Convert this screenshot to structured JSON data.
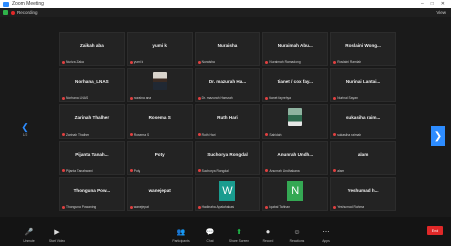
{
  "window": {
    "title": "Zoom Meeting",
    "controls": [
      "–",
      "□",
      "✕"
    ]
  },
  "infobar": {
    "recording": "Recording",
    "view": "View"
  },
  "participants": [
    {
      "name": "Zaikah aba",
      "label": "Nuriza Zaka"
    },
    {
      "name": "yumi k",
      "label": "yumi k"
    },
    {
      "name": "Nuraisha",
      "label": "Nuraisha"
    },
    {
      "name": "Nuraimah Abu...",
      "label": "Nuraimah Ramadong"
    },
    {
      "name": "Roslaini Wong...",
      "label": "Roslaini Ramlah"
    },
    {
      "name": "Norhana_LNAS",
      "label": "Norhana LNAS"
    },
    {
      "name": "",
      "label": "noraina ana",
      "avatar": "person"
    },
    {
      "name": "Dr. mazurah Ha...",
      "label": "Dr. mazurah Hamzah"
    },
    {
      "name": "tianet / cox fay...",
      "label": "tianet fayrehya"
    },
    {
      "name": "Nurinai Lantai...",
      "label": "Nurinai Sayan"
    },
    {
      "name": "Zarinah Thalher",
      "label": "Zarinah Thalher"
    },
    {
      "name": "Rosema S",
      "label": "Rosema S"
    },
    {
      "name": "Ruth Hari",
      "label": "Ruth Hari"
    },
    {
      "name": "",
      "label": "Sahidah",
      "avatar": "scene"
    },
    {
      "name": "sukasiha raim...",
      "label": "sukasiha raimah"
    },
    {
      "name": "Pijanta Tanah...",
      "label": "Pijanta Tanahwani"
    },
    {
      "name": "Poty",
      "label": "Poty"
    },
    {
      "name": "Suchorya Rongdal",
      "label": "Suchorya Rongdal"
    },
    {
      "name": "Anunrah Undh...",
      "label": "Anunrah Undhakana"
    },
    {
      "name": "alam",
      "label": "alam"
    },
    {
      "name": "Thonguna Pow...",
      "label": "Thonguna Powaning"
    },
    {
      "name": "wanejepat",
      "label": "wanejepat"
    },
    {
      "name": "",
      "label": "Hadinaha Apalahakasi",
      "letter": "W",
      "letter_color": "#1a9c8f"
    },
    {
      "name": "",
      "label": "Iqabal Tahhan",
      "letter": "N",
      "letter_color": "#34a853"
    },
    {
      "name": "Yeshumad h...",
      "label": "Yeshumad Rahma"
    }
  ],
  "pagination": {
    "left_arrow": "❮",
    "left_page": "1/2",
    "right_arrow": "❯"
  },
  "toolbar": {
    "left": [
      {
        "icon": "🎤",
        "label": "Unmute"
      },
      {
        "icon": "▶",
        "label": "Start Video"
      }
    ],
    "center": [
      {
        "icon": "👥",
        "label": "Participants"
      },
      {
        "icon": "💬",
        "label": "Chat"
      },
      {
        "icon": "⬆",
        "label": "Share Screen",
        "green": true
      },
      {
        "icon": "⏺",
        "label": "Record"
      },
      {
        "icon": "☺",
        "label": "Reactions"
      },
      {
        "icon": "⋯",
        "label": "Apps"
      }
    ],
    "end_label": "End"
  }
}
